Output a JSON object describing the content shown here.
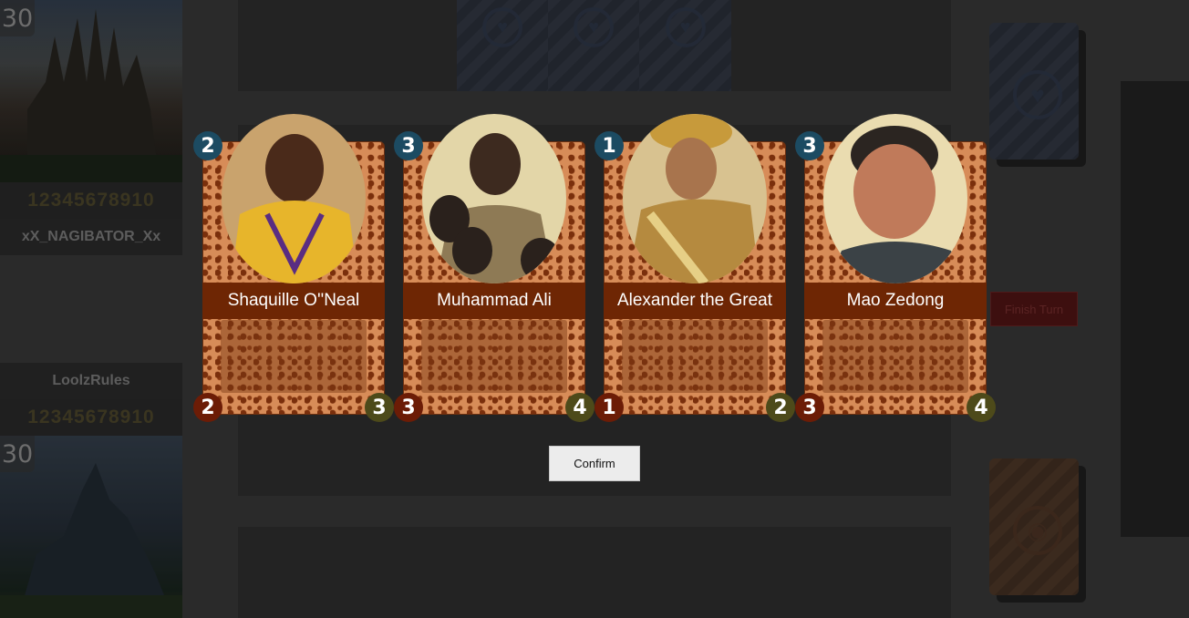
{
  "players": {
    "opponent": {
      "name": "xX_NAGIBATOR_Xx",
      "lives": "30",
      "mana_numbers": "12345678910"
    },
    "self": {
      "name": "LoolzRules",
      "lives": "30",
      "mana_numbers": "12345678910"
    }
  },
  "controls": {
    "finish_turn_label": "Finish Turn",
    "confirm_label": "Confirm"
  },
  "choice_cards": [
    {
      "name": "Shaquille O''Neal",
      "cost": "2",
      "attack": "2",
      "health": "3"
    },
    {
      "name": "Muhammad Ali",
      "cost": "3",
      "attack": "3",
      "health": "4"
    },
    {
      "name": "Alexander the Great",
      "cost": "1",
      "attack": "1",
      "health": "2"
    },
    {
      "name": "Mao Zedong",
      "cost": "3",
      "attack": "3",
      "health": "4"
    }
  ],
  "icons": {
    "card_back_emblem": "heart-icon",
    "own_deck_emblem": "eye-icon"
  },
  "colors": {
    "cost_badge": "#1c4b62",
    "attack_badge": "#6c1c06",
    "health_badge": "#4d4a1a",
    "name_strip": "#6e2604",
    "card_face": "#d78c58"
  }
}
